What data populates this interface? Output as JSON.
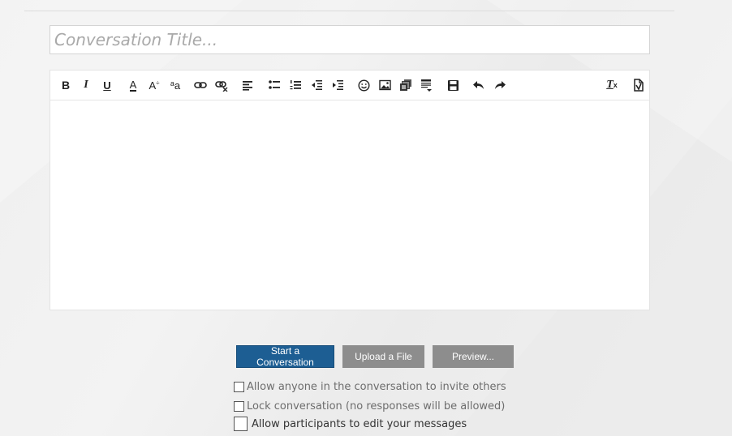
{
  "form": {
    "title_placeholder": "Conversation Title...",
    "title_value": ""
  },
  "toolbar": {
    "buttons": [
      {
        "name": "bold",
        "glyph": "B"
      },
      {
        "name": "italic",
        "glyph": "I"
      },
      {
        "name": "underline",
        "glyph": "U"
      },
      {
        "name": "text-color",
        "glyph": "A"
      },
      {
        "name": "font-size",
        "glyph": "A"
      },
      {
        "name": "font-family",
        "glyph": "a"
      },
      {
        "name": "link"
      },
      {
        "name": "unlink"
      },
      {
        "name": "align-left"
      },
      {
        "name": "bullet-list"
      },
      {
        "name": "numbered-list"
      },
      {
        "name": "outdent"
      },
      {
        "name": "indent"
      },
      {
        "name": "smilie"
      },
      {
        "name": "image"
      },
      {
        "name": "media"
      },
      {
        "name": "insert"
      },
      {
        "name": "save-draft"
      },
      {
        "name": "undo"
      },
      {
        "name": "redo"
      },
      {
        "name": "remove-format"
      },
      {
        "name": "toggle-bbcode"
      }
    ],
    "glyphs": {
      "bold": "B",
      "italic": "I",
      "underline": "U",
      "text_color": "A",
      "font_size_a": "A",
      "font_size_mark": "÷",
      "font_family_a": "a",
      "font_family_b": "a",
      "remove_format": "T",
      "remove_format_x": "x"
    }
  },
  "actions": {
    "start_label": "Start a Conversation",
    "upload_label": "Upload a File",
    "preview_label": "Preview..."
  },
  "options": {
    "allow_invite": "Allow anyone in the conversation to invite others",
    "lock": "Lock conversation (no responses will be allowed)",
    "allow_edit": "Allow participants to edit your messages"
  },
  "colors": {
    "primary_button": "#1d5e93",
    "secondary_button": "#8d8d8d",
    "toolbar_icon": "#222222"
  }
}
